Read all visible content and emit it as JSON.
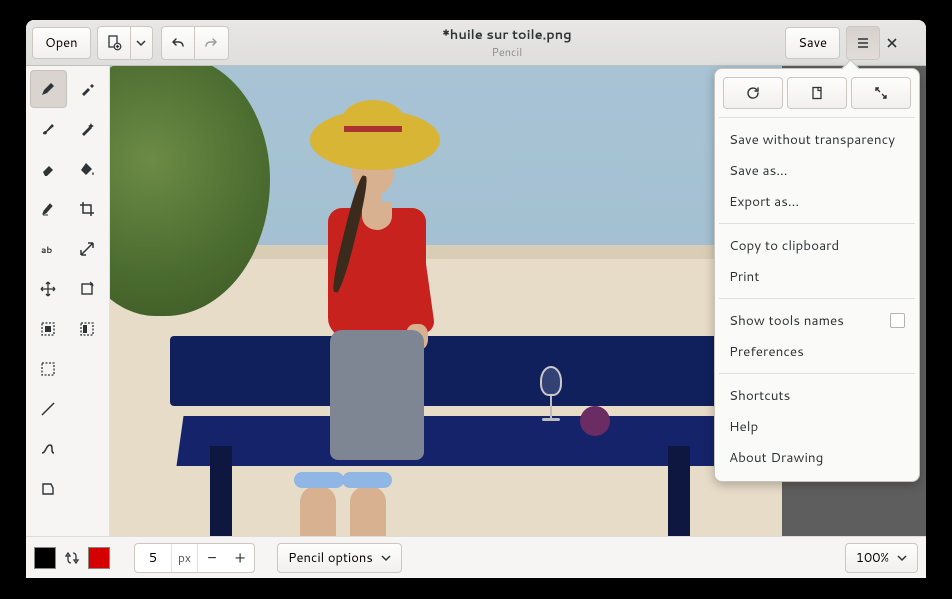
{
  "header": {
    "open_label": "Open",
    "filename": "*huile sur toile.png",
    "subtitle": "Pencil",
    "save_label": "Save"
  },
  "menu": {
    "save_no_alpha": "Save without transparency",
    "save_as": "Save as…",
    "export_as": "Export as…",
    "copy_clip": "Copy to clipboard",
    "print": "Print",
    "show_tool_names": "Show tools names",
    "preferences": "Preferences",
    "shortcuts": "Shortcuts",
    "help": "Help",
    "about": "About Drawing"
  },
  "bottom": {
    "size_value": "5",
    "size_unit": "px",
    "options_label": "Pencil options",
    "zoom": "100%"
  },
  "colors": {
    "primary": "#000000",
    "secondary": "#d40000"
  }
}
